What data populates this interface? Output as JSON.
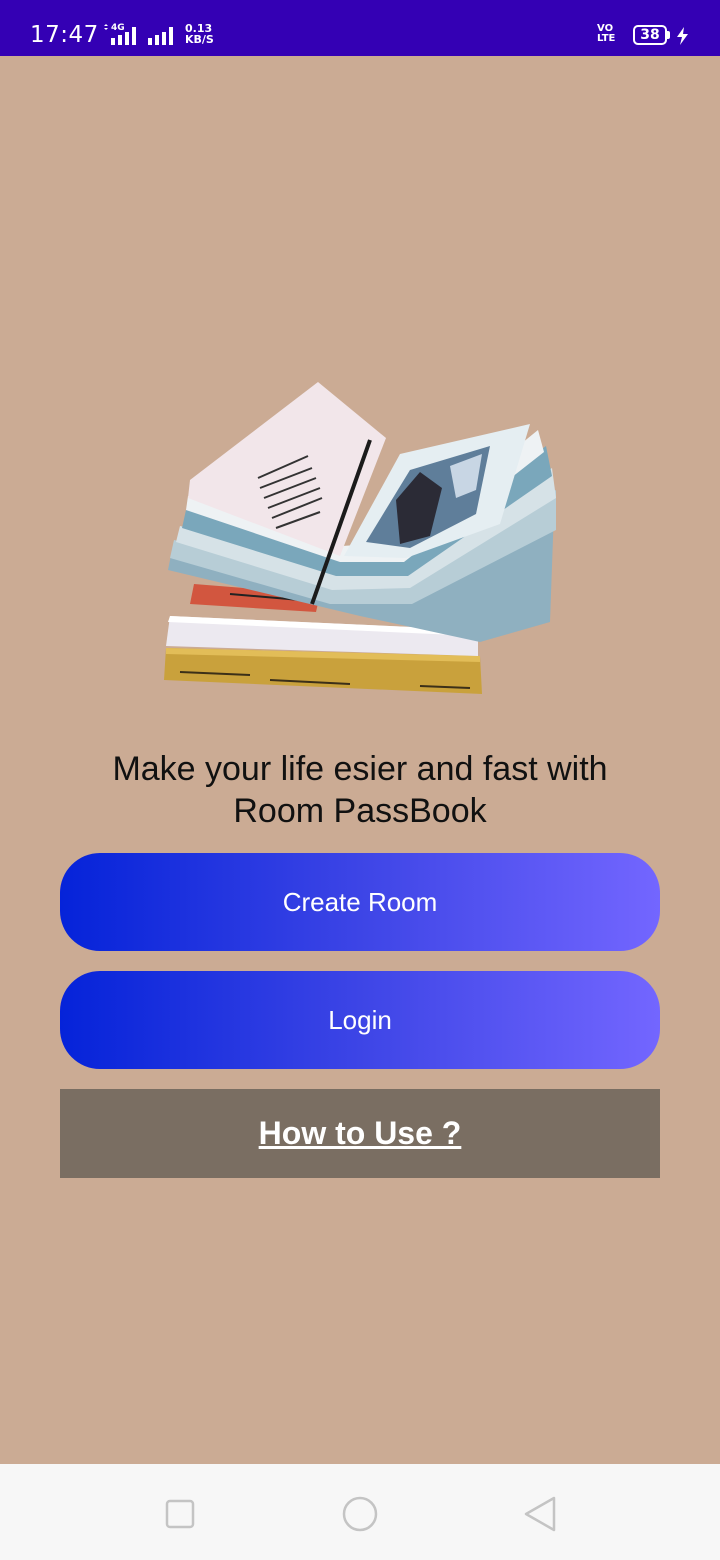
{
  "status_bar": {
    "time": "17:47",
    "network_type": "4G",
    "speed_value": "0.13",
    "speed_unit": "KB/S",
    "volte_top": "VO",
    "volte_bottom": "LTE",
    "battery_level": "38",
    "icons": [
      "signal-4g-icon",
      "signal-bars-icon",
      "volte-icon",
      "battery-icon",
      "charging-icon"
    ]
  },
  "main": {
    "hero_image": "stack-of-open-books-image",
    "tagline_line1": "Make your life esier and fast with",
    "tagline_line2": "Room PassBook",
    "create_room_label": "Create Room",
    "login_label": "Login",
    "how_to_use_label": "How to Use ?"
  },
  "nav_bar": {
    "icons": [
      "recents-square-icon",
      "home-circle-icon",
      "back-triangle-icon"
    ]
  },
  "colors": {
    "status_bar_bg": "#3400b4",
    "page_bg": "#cbab94",
    "button_gradient_start": "#0523d9",
    "button_gradient_end": "#7366ff",
    "how_to_bg": "#7a6e62",
    "nav_bar_bg": "#f7f7f7"
  }
}
